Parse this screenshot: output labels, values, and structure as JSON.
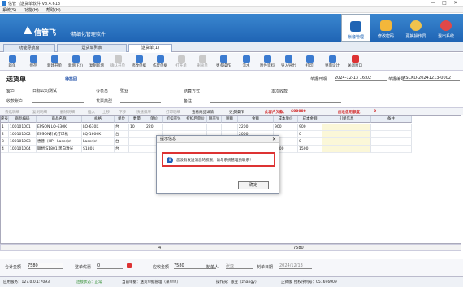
{
  "window": {
    "title": "信管飞送货单软件 V8.4.613",
    "minimize": "—",
    "maximize": "□",
    "close": "✕"
  },
  "menu": [
    "系统(S)",
    "功能(H)",
    "帮助(H)"
  ],
  "banner": {
    "logo": "信管飞",
    "subtitle": "·精细化管理软件",
    "buttons": [
      "帐套管理",
      "修改密码",
      "更换操作员",
      "退出系统"
    ]
  },
  "tabs": [
    "功能导航窗",
    "送货单列表",
    "送货单(1)"
  ],
  "toolbar": [
    {
      "label": "新单",
      "icon": "new-icon",
      "color": "#3b7bd0",
      "enabled": true
    },
    {
      "label": "保存",
      "icon": "save-icon",
      "color": "#3b7bd0",
      "enabled": true
    },
    {
      "label": "新建开单",
      "icon": "new-order-icon",
      "color": "#3b7bd0",
      "enabled": true
    },
    {
      "label": "新增(F2)",
      "icon": "add-icon",
      "color": "#3b7bd0",
      "enabled": true
    },
    {
      "label": "复制新增",
      "icon": "copy-add-icon",
      "color": "#3b7bd0",
      "enabled": true
    },
    {
      "label": "确认开单",
      "icon": "confirm-icon",
      "color": "#c9c9c9",
      "enabled": false
    },
    {
      "label": "修改单据",
      "icon": "edit-icon",
      "color": "#3b7bd0",
      "enabled": true
    },
    {
      "label": "作废单据",
      "icon": "void-icon",
      "color": "#3b7bd0",
      "enabled": true
    },
    {
      "label": "打开单",
      "icon": "open-icon",
      "color": "#c9c9c9",
      "enabled": false
    },
    {
      "label": "删除单",
      "icon": "delete-icon",
      "color": "#c9c9c9",
      "enabled": false
    },
    {
      "label": "更多操作",
      "icon": "more-icon",
      "color": "#3b7bd0",
      "enabled": true
    },
    {
      "label": "流水",
      "icon": "list-icon",
      "color": "#3b7bd0",
      "enabled": true
    },
    {
      "label": "附件资料",
      "icon": "attach-icon",
      "color": "#3b7bd0",
      "enabled": true
    },
    {
      "label": "导入导出",
      "icon": "import-icon",
      "color": "#3b7bd0",
      "enabled": true
    },
    {
      "label": "打印",
      "icon": "print-icon",
      "color": "#3b7bd0",
      "enabled": true
    },
    {
      "label": "界面设计",
      "icon": "design-icon",
      "color": "#3b7bd0",
      "enabled": true
    },
    {
      "label": "关闭窗口",
      "icon": "close-window-icon",
      "color": "#d33",
      "enabled": true
    }
  ],
  "form": {
    "title": "送货单",
    "status": "待签回",
    "date_label": "单据日期",
    "date": "2024-12-13 16:02",
    "number_label": "单据编号",
    "number": "XSCKD-20241213-0002",
    "customer_label": "客户",
    "customer": "日标公司测试",
    "salesman_label": "业务员",
    "salesman": "张亚",
    "settle_label": "结算方式",
    "settle": "",
    "receivable_label": "本次收款",
    "receivable": "",
    "account_label": "收款账户",
    "account": "",
    "invoice_label": "发票类型",
    "invoice": "",
    "remark_label": "备注",
    "remark": ""
  },
  "subtoolbar": {
    "items": [
      "去选明细",
      "复制明细",
      "删除明细",
      "插入",
      "上移",
      "下移",
      "快速排序",
      "打印明细",
      "查看商品详情",
      "更多操作"
    ],
    "credit_label": "此客户欠款：",
    "credit_value": "600000",
    "limit_label": "应收信用额度：",
    "limit_value": "0"
  },
  "grid": {
    "columns": [
      "序号",
      "商品编码",
      "商品名称",
      "规格",
      "单位",
      "数量",
      "单价",
      "折扣率%",
      "折扣后单价",
      "税率%",
      "税额",
      "金额",
      "成本单价",
      "成本金额",
      "引单信息",
      "备注"
    ],
    "rows": [
      [
        "1",
        "100101001",
        "EPSON LQ-630K",
        "LQ-630K",
        "台",
        "10",
        "220",
        "",
        "",
        "",
        "",
        "2200",
        "900",
        "900",
        "",
        ""
      ],
      [
        "2",
        "100101002",
        "EPSON针式打印机",
        "LQ-1600K",
        "台",
        "",
        "",
        "",
        "",
        "",
        "",
        "2000",
        "",
        "0",
        "",
        ""
      ],
      [
        "3",
        "100101003",
        "惠普（HP）LaserJet",
        "LaserJet",
        "台",
        "",
        "",
        "",
        "",
        "",
        "",
        "1180",
        "",
        "0",
        "",
        ""
      ],
      [
        "4",
        "100101004",
        "联想 S1801 黑白激光",
        "S1801",
        "台",
        "",
        "",
        "",
        "",
        "",
        "",
        "1200",
        "1500",
        "1500",
        "",
        ""
      ]
    ],
    "footer_count": "4",
    "footer_amount": "7580"
  },
  "footer": {
    "total_label": "合计金额",
    "total": "7580",
    "discount_label": "整单优惠",
    "discount": "0",
    "receivable_label": "应收金额",
    "receivable": "7580",
    "maker_label": "制单人",
    "maker": "张亚",
    "make_date_label": "制单日期",
    "make_date": "2024/12/13"
  },
  "statusbar": {
    "server": "应用服务：127.0.0.1:7093",
    "conn": "连接状态：正常",
    "module": "当前单据：送货单据管理（录单单）",
    "operator": "操作员：张亚（zhangy）",
    "version": "正式版",
    "license": "授权序列号：051696909"
  },
  "dialog": {
    "title": "提示信息",
    "close": "✕",
    "message": "您没有发送消息的权限，请与系统管理员联系！",
    "ok": "确定"
  }
}
